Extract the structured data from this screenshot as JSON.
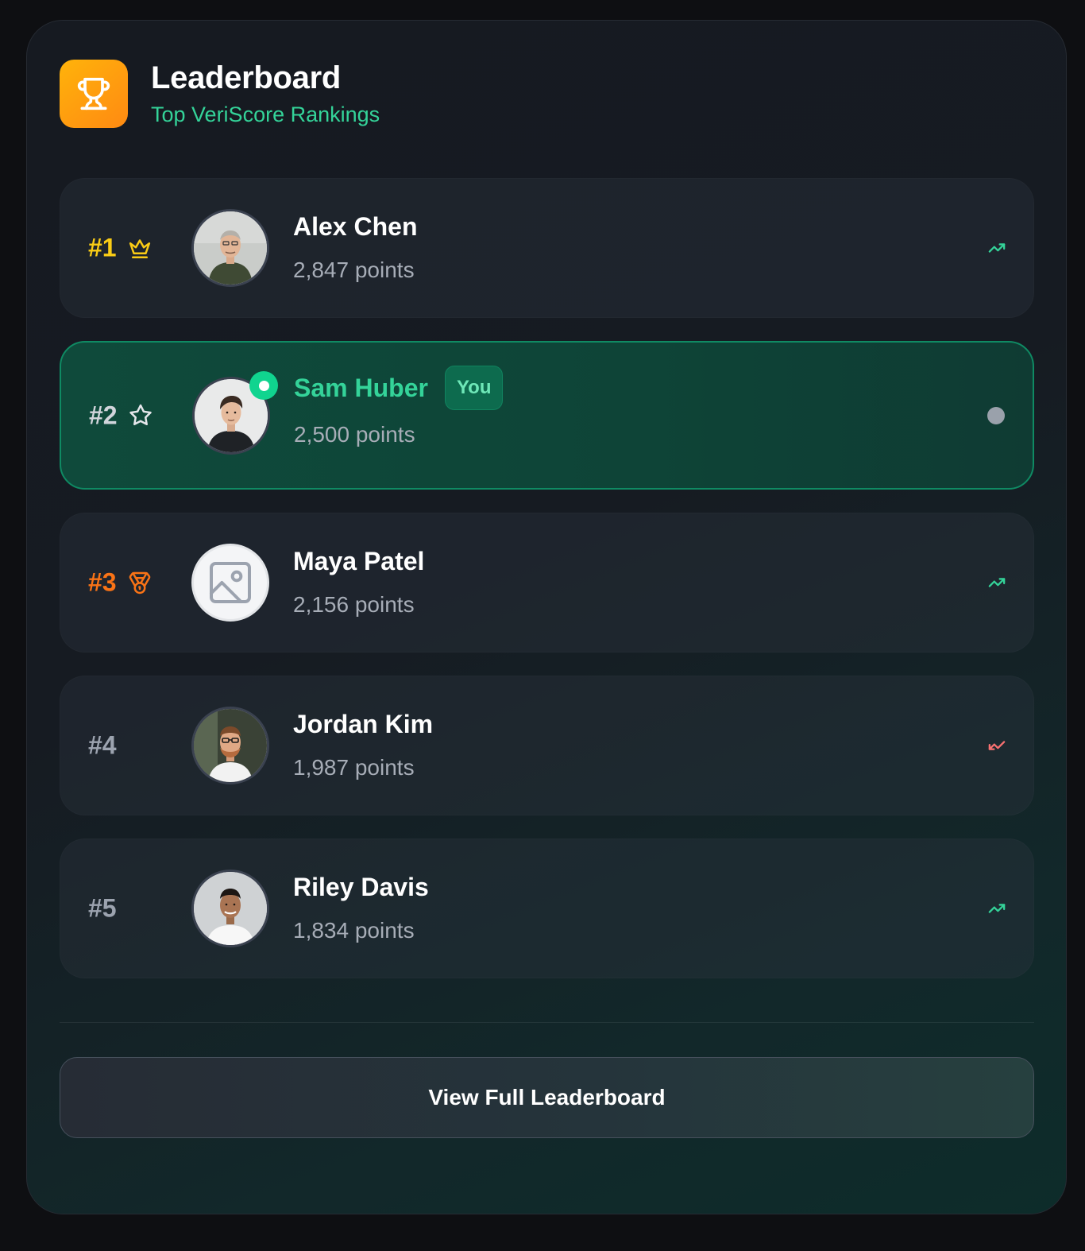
{
  "header": {
    "title": "Leaderboard",
    "subtitle": "Top VeriScore Rankings",
    "icon": "trophy-icon"
  },
  "colors": {
    "accent": "#34d399",
    "gold": "#facc15",
    "bronze": "#f97316",
    "trend_up": "#34d399",
    "trend_down": "#f87171"
  },
  "entries": [
    {
      "rank": "#1",
      "name": "Alex Chen",
      "points": "2,847 points",
      "rank_icon": "crown-icon",
      "trend": "trending-up-icon"
    },
    {
      "rank": "#2",
      "name": "Sam Huber",
      "points": "2,500 points",
      "rank_icon": "star-icon",
      "trend": "neutral-dot",
      "badge": "You",
      "online": true
    },
    {
      "rank": "#3",
      "name": "Maya Patel",
      "points": "2,156 points",
      "rank_icon": "medal-icon",
      "trend": "trending-up-icon",
      "avatar": "image-placeholder-icon"
    },
    {
      "rank": "#4",
      "name": "Jordan Kim",
      "points": "1,987 points",
      "trend": "trending-down-icon"
    },
    {
      "rank": "#5",
      "name": "Riley Davis",
      "points": "1,834 points",
      "trend": "trending-up-icon"
    }
  ],
  "footer": {
    "button_label": "View Full Leaderboard"
  }
}
